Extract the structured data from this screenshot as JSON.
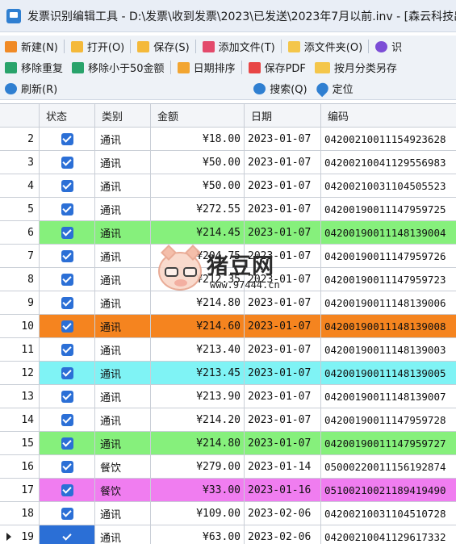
{
  "window": {
    "title": "发票识别编辑工具 - D:\\发票\\收到发票\\2023\\已发送\\2023年7月以前.inv - [森云科技出品"
  },
  "toolbar_row1": [
    {
      "name": "new-button",
      "icon": "new-icon",
      "label": "新建(N)"
    },
    {
      "name": "open-button",
      "icon": "folder-icon",
      "label": "打开(O)"
    },
    {
      "name": "save-button",
      "icon": "save-icon",
      "label": "保存(S)"
    },
    {
      "name": "add-file-button",
      "icon": "add-file-icon",
      "label": "添加文件(T)"
    },
    {
      "name": "add-folder-button",
      "icon": "add-folder-icon",
      "label": "添文件夹(O)"
    },
    {
      "name": "recognize-button",
      "icon": "recognize-icon",
      "label": "识"
    }
  ],
  "toolbar_row2": [
    {
      "name": "remove-duplicates-button",
      "icon": "dedup-icon",
      "label": "移除重复"
    },
    {
      "name": "remove-under-50-button",
      "icon": "trash-icon",
      "label": "移除小于50金额"
    },
    {
      "name": "sort-by-date-button",
      "icon": "calendar-icon",
      "label": "日期排序"
    },
    {
      "name": "save-pdf-button",
      "icon": "pdf-icon",
      "label": "保存PDF"
    },
    {
      "name": "save-by-month-button",
      "icon": "month-folder-icon",
      "label": "按月分类另存"
    }
  ],
  "toolbar_row3": {
    "refresh": {
      "icon": "refresh-icon",
      "label": "刷新(R)"
    },
    "search": {
      "icon": "search-icon",
      "label": "搜索(Q)"
    },
    "locate": {
      "icon": "locate-icon",
      "label": "定位"
    }
  },
  "table": {
    "columns": [
      "",
      "状态",
      "类别",
      "金额",
      "日期",
      "编码"
    ],
    "rows": [
      {
        "idx": "2",
        "checked": true,
        "category": "通讯",
        "amount": "¥18.00",
        "date": "2023-01-07",
        "code": "04200210011154923628",
        "highlight": ""
      },
      {
        "idx": "3",
        "checked": true,
        "category": "通讯",
        "amount": "¥50.00",
        "date": "2023-01-07",
        "code": "04200210041129556983",
        "highlight": ""
      },
      {
        "idx": "4",
        "checked": true,
        "category": "通讯",
        "amount": "¥50.00",
        "date": "2023-01-07",
        "code": "04200210031104505523",
        "highlight": ""
      },
      {
        "idx": "5",
        "checked": true,
        "category": "通讯",
        "amount": "¥272.55",
        "date": "2023-01-07",
        "code": "04200190011147959725",
        "highlight": ""
      },
      {
        "idx": "6",
        "checked": true,
        "category": "通讯",
        "amount": "¥214.45",
        "date": "2023-01-07",
        "code": "04200190011148139004",
        "highlight": "#86f07c"
      },
      {
        "idx": "7",
        "checked": true,
        "category": "通讯",
        "amount": "¥204.75",
        "date": "2023-01-07",
        "code": "04200190011147959726",
        "highlight": ""
      },
      {
        "idx": "8",
        "checked": true,
        "category": "通讯",
        "amount": "¥212.35",
        "date": "2023-01-07",
        "code": "04200190011147959723",
        "highlight": ""
      },
      {
        "idx": "9",
        "checked": true,
        "category": "通讯",
        "amount": "¥214.80",
        "date": "2023-01-07",
        "code": "04200190011148139006",
        "highlight": ""
      },
      {
        "idx": "10",
        "checked": true,
        "category": "通讯",
        "amount": "¥214.60",
        "date": "2023-01-07",
        "code": "04200190011148139008",
        "highlight": "#f5841f"
      },
      {
        "idx": "11",
        "checked": true,
        "category": "通讯",
        "amount": "¥213.40",
        "date": "2023-01-07",
        "code": "04200190011148139003",
        "highlight": ""
      },
      {
        "idx": "12",
        "checked": true,
        "category": "通讯",
        "amount": "¥213.45",
        "date": "2023-01-07",
        "code": "04200190011148139005",
        "highlight": "#7ff3f5"
      },
      {
        "idx": "13",
        "checked": true,
        "category": "通讯",
        "amount": "¥213.90",
        "date": "2023-01-07",
        "code": "04200190011148139007",
        "highlight": ""
      },
      {
        "idx": "14",
        "checked": true,
        "category": "通讯",
        "amount": "¥214.20",
        "date": "2023-01-07",
        "code": "04200190011147959728",
        "highlight": ""
      },
      {
        "idx": "15",
        "checked": true,
        "category": "通讯",
        "amount": "¥214.80",
        "date": "2023-01-07",
        "code": "04200190011147959727",
        "highlight": "#86f07c"
      },
      {
        "idx": "16",
        "checked": true,
        "category": "餐饮",
        "amount": "¥279.00",
        "date": "2023-01-14",
        "code": "05000220011156192874",
        "highlight": ""
      },
      {
        "idx": "17",
        "checked": true,
        "category": "餐饮",
        "amount": "¥33.00",
        "date": "2023-01-16",
        "code": "05100210021189419490",
        "highlight": "#f07df0"
      },
      {
        "idx": "18",
        "checked": true,
        "category": "通讯",
        "amount": "¥109.00",
        "date": "2023-02-06",
        "code": "04200210031104510728",
        "highlight": ""
      },
      {
        "idx": "19",
        "checked": true,
        "category": "通讯",
        "amount": "¥63.00",
        "date": "2023-02-06",
        "code": "04200210041129617332",
        "highlight": "",
        "current": true
      }
    ]
  },
  "watermark": {
    "name": "猪豆网",
    "url": "www.97444.cn"
  },
  "colors": {
    "accent": "#2b6fd6",
    "titlebar": "#e9eef6",
    "toolbar": "#eef2f7"
  }
}
